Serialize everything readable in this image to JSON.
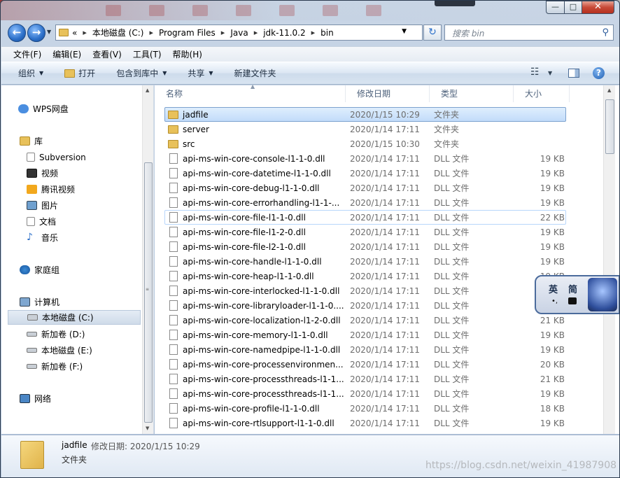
{
  "window": {
    "minimize_label": "—",
    "maximize_label": "□",
    "close_label": "✕"
  },
  "address": {
    "history_label": "«",
    "crumbs": [
      "本地磁盘 (C:)",
      "Program Files",
      "Java",
      "jdk-11.0.2",
      "bin"
    ],
    "search_placeholder": "搜索 bin"
  },
  "menu": [
    "文件(F)",
    "编辑(E)",
    "查看(V)",
    "工具(T)",
    "帮助(H)"
  ],
  "toolbar": {
    "organize": "组织",
    "open": "打开",
    "include_library": "包含到库中",
    "share": "共享",
    "new_folder": "新建文件夹"
  },
  "nav": {
    "wps": "WPS网盘",
    "library": "库",
    "subversion": "Subversion",
    "video": "视频",
    "tencent_video": "腾讯视频",
    "pictures": "图片",
    "documents": "文档",
    "music": "音乐",
    "homegroup": "家庭组",
    "computer": "计算机",
    "drive_c": "本地磁盘 (C:)",
    "drive_d": "新加卷 (D:)",
    "drive_e": "本地磁盘 (E:)",
    "drive_f": "新加卷 (F:)",
    "network": "网络"
  },
  "columns": {
    "name": "名称",
    "date": "修改日期",
    "type": "类型",
    "size": "大小"
  },
  "files": [
    {
      "name": "jadfile",
      "date": "2020/1/15 10:29",
      "type": "文件夹",
      "size": "",
      "kind": "folder"
    },
    {
      "name": "server",
      "date": "2020/1/14 17:11",
      "type": "文件夹",
      "size": "",
      "kind": "folder"
    },
    {
      "name": "src",
      "date": "2020/1/15 10:30",
      "type": "文件夹",
      "size": "",
      "kind": "folder"
    },
    {
      "name": "api-ms-win-core-console-l1-1-0.dll",
      "date": "2020/1/14 17:11",
      "type": "DLL 文件",
      "size": "19 KB",
      "kind": "file"
    },
    {
      "name": "api-ms-win-core-datetime-l1-1-0.dll",
      "date": "2020/1/14 17:11",
      "type": "DLL 文件",
      "size": "19 KB",
      "kind": "file"
    },
    {
      "name": "api-ms-win-core-debug-l1-1-0.dll",
      "date": "2020/1/14 17:11",
      "type": "DLL 文件",
      "size": "19 KB",
      "kind": "file"
    },
    {
      "name": "api-ms-win-core-errorhandling-l1-1-...",
      "date": "2020/1/14 17:11",
      "type": "DLL 文件",
      "size": "19 KB",
      "kind": "file"
    },
    {
      "name": "api-ms-win-core-file-l1-1-0.dll",
      "date": "2020/1/14 17:11",
      "type": "DLL 文件",
      "size": "22 KB",
      "kind": "file"
    },
    {
      "name": "api-ms-win-core-file-l1-2-0.dll",
      "date": "2020/1/14 17:11",
      "type": "DLL 文件",
      "size": "19 KB",
      "kind": "file"
    },
    {
      "name": "api-ms-win-core-file-l2-1-0.dll",
      "date": "2020/1/14 17:11",
      "type": "DLL 文件",
      "size": "19 KB",
      "kind": "file"
    },
    {
      "name": "api-ms-win-core-handle-l1-1-0.dll",
      "date": "2020/1/14 17:11",
      "type": "DLL 文件",
      "size": "19 KB",
      "kind": "file"
    },
    {
      "name": "api-ms-win-core-heap-l1-1-0.dll",
      "date": "2020/1/14 17:11",
      "type": "DLL 文件",
      "size": "19 KB",
      "kind": "file"
    },
    {
      "name": "api-ms-win-core-interlocked-l1-1-0.dll",
      "date": "2020/1/14 17:11",
      "type": "DLL 文件",
      "size": "",
      "kind": "file"
    },
    {
      "name": "api-ms-win-core-libraryloader-l1-1-0....",
      "date": "2020/1/14 17:11",
      "type": "DLL 文件",
      "size": "",
      "kind": "file"
    },
    {
      "name": "api-ms-win-core-localization-l1-2-0.dll",
      "date": "2020/1/14 17:11",
      "type": "DLL 文件",
      "size": "21 KB",
      "kind": "file"
    },
    {
      "name": "api-ms-win-core-memory-l1-1-0.dll",
      "date": "2020/1/14 17:11",
      "type": "DLL 文件",
      "size": "19 KB",
      "kind": "file"
    },
    {
      "name": "api-ms-win-core-namedpipe-l1-1-0.dll",
      "date": "2020/1/14 17:11",
      "type": "DLL 文件",
      "size": "19 KB",
      "kind": "file"
    },
    {
      "name": "api-ms-win-core-processenvironmen...",
      "date": "2020/1/14 17:11",
      "type": "DLL 文件",
      "size": "20 KB",
      "kind": "file"
    },
    {
      "name": "api-ms-win-core-processthreads-l1-1...",
      "date": "2020/1/14 17:11",
      "type": "DLL 文件",
      "size": "21 KB",
      "kind": "file"
    },
    {
      "name": "api-ms-win-core-processthreads-l1-1...",
      "date": "2020/1/14 17:11",
      "type": "DLL 文件",
      "size": "19 KB",
      "kind": "file"
    },
    {
      "name": "api-ms-win-core-profile-l1-1-0.dll",
      "date": "2020/1/14 17:11",
      "type": "DLL 文件",
      "size": "18 KB",
      "kind": "file"
    },
    {
      "name": "api-ms-win-core-rtlsupport-l1-1-0.dll",
      "date": "2020/1/14 17:11",
      "type": "DLL 文件",
      "size": "19 KB",
      "kind": "file"
    }
  ],
  "details": {
    "name": "jadfile",
    "meta": "修改日期: 2020/1/15 10:29",
    "type": "文件夹"
  },
  "watermark": "https://blog.csdn.net/weixin_41987908",
  "widget": {
    "char1": "英",
    "char2": "简"
  },
  "colors": {
    "accent": "#2a6ec8",
    "selection": "#c2dcfa",
    "folder": "#e8c15a"
  }
}
